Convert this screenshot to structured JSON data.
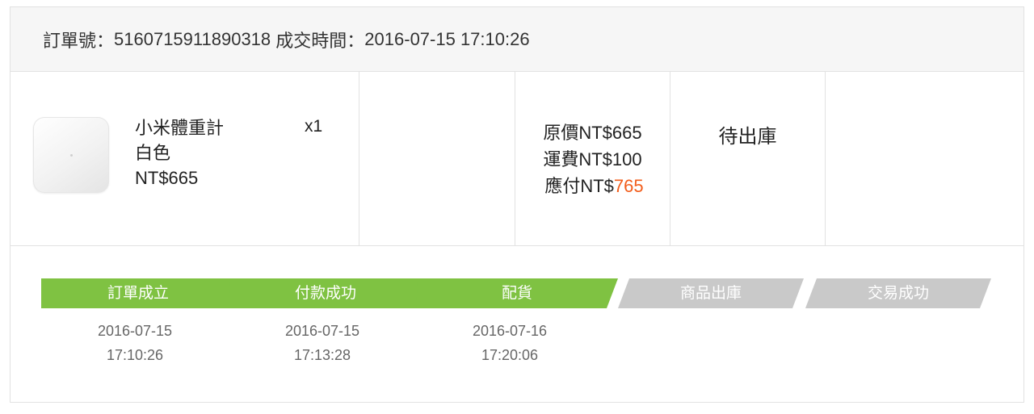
{
  "order": {
    "number_label": "訂單號：",
    "number": "5160715911890318",
    "time_label": "成交時間：",
    "time": "2016-07-15 17:10:26"
  },
  "item": {
    "name": "小米體重計",
    "color": "白色",
    "price": "NT$665",
    "quantity": "x1",
    "thumbnail_icon": "bathroom-scale-image"
  },
  "pricing": {
    "original_label": "原價",
    "original_amount": "NT$665",
    "shipping_label": "運費",
    "shipping_amount": "NT$100",
    "payable_label": "應付",
    "payable_currency": "NT$",
    "payable_amount": "765"
  },
  "status": "待出庫",
  "progress": {
    "steps": [
      {
        "label": "訂單成立",
        "done": true,
        "date": "2016-07-15",
        "time": "17:10:26"
      },
      {
        "label": "付款成功",
        "done": true,
        "date": "2016-07-15",
        "time": "17:13:28"
      },
      {
        "label": "配貨",
        "done": true,
        "date": "2016-07-16",
        "time": "17:20:06"
      },
      {
        "label": "商品出庫",
        "done": false
      },
      {
        "label": "交易成功",
        "done": false
      }
    ]
  },
  "colors": {
    "step_done": "#7fc242",
    "step_todo": "#c9c9c9",
    "amount_highlight": "#f25d1b"
  }
}
